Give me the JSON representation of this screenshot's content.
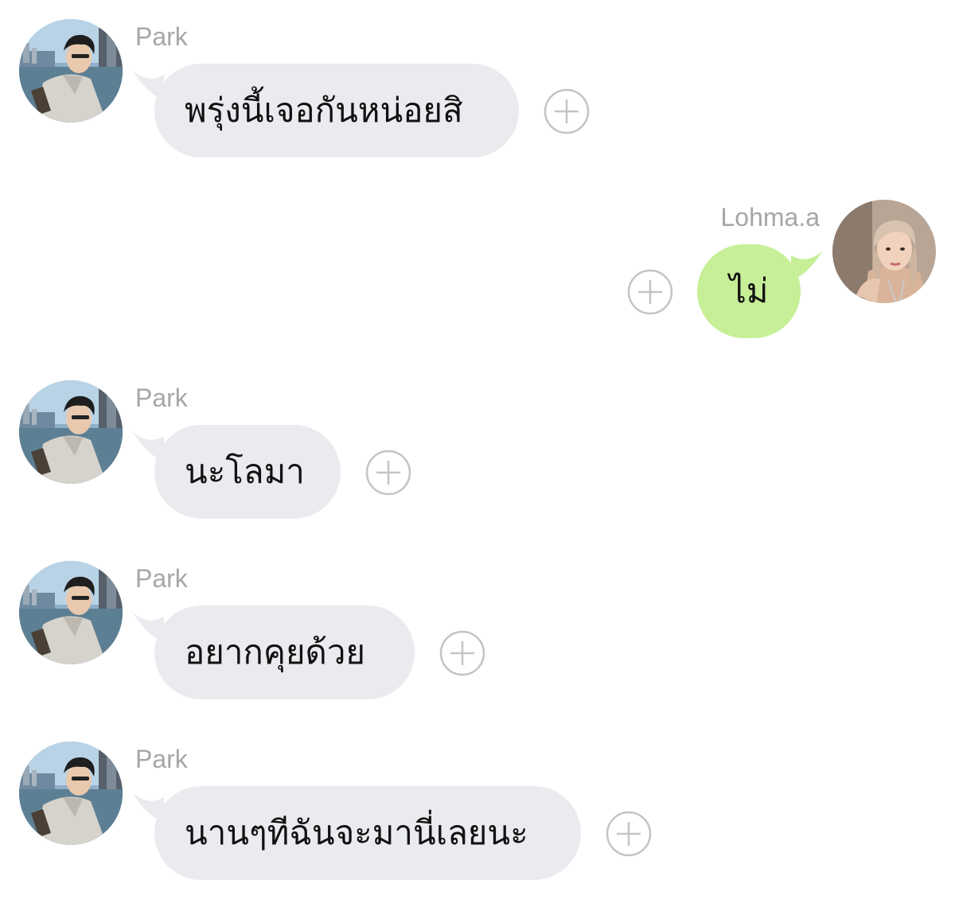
{
  "messages": [
    {
      "sender": "Park",
      "text": "พรุ่งนี้เจอกันหน่อยสิ",
      "direction": "incoming"
    },
    {
      "sender": "Lohma.a",
      "text": "ไม่",
      "direction": "outgoing"
    },
    {
      "sender": "Park",
      "text": "นะโลมา",
      "direction": "incoming"
    },
    {
      "sender": "Park",
      "text": "อยากคุยด้วย",
      "direction": "incoming"
    },
    {
      "sender": "Park",
      "text": "นานๆทีฉันจะมานี่เลยนะ",
      "direction": "incoming"
    }
  ],
  "icons": {
    "add_reaction": "plus-circle-icon",
    "avatar_park": "avatar-park",
    "avatar_lohma": "avatar-lohma"
  },
  "colors": {
    "incoming_bubble": "#e9ebee",
    "outgoing_bubble": "#c7ef98",
    "sender_name": "#a6a6a6",
    "plus_icon": "#c4c4c4"
  }
}
